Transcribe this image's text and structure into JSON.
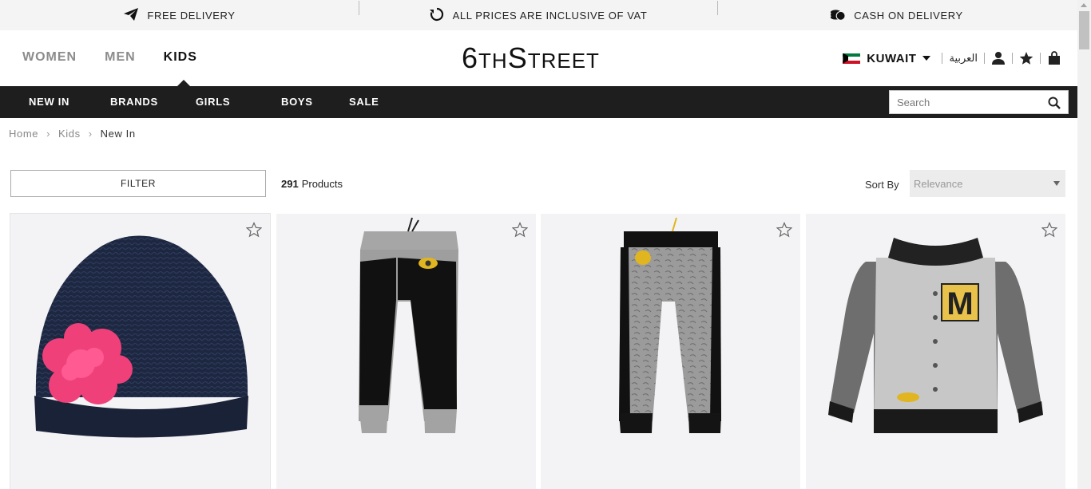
{
  "promo": {
    "items": [
      {
        "icon": "paper-plane-icon",
        "label": "FREE DELIVERY"
      },
      {
        "icon": "refresh-icon",
        "label": "ALL PRICES ARE INCLUSIVE OF VAT"
      },
      {
        "icon": "coins-icon",
        "label": "CASH ON DELIVERY"
      }
    ]
  },
  "header": {
    "gender_tabs": [
      {
        "label": "WOMEN",
        "active": false
      },
      {
        "label": "MEN",
        "active": false
      },
      {
        "label": "KIDS",
        "active": true
      }
    ],
    "logo_main": "6",
    "logo_th": "TH",
    "logo_s": "S",
    "logo_rest": "TREET",
    "country": "KUWAIT",
    "language": "العربية"
  },
  "catnav": {
    "items": [
      "NEW IN",
      "BRANDS",
      "GIRLS",
      "BOYS",
      "SALE"
    ]
  },
  "search": {
    "placeholder": "Search"
  },
  "breadcrumb": {
    "items": [
      "Home",
      "Kids",
      "New In"
    ]
  },
  "toolbar": {
    "filter_label": "FILTER",
    "product_count": "291",
    "product_count_label": "Products",
    "sort_label": "Sort By",
    "sort_value": "Relevance"
  },
  "products": [
    {
      "name": "navy-knit-beanie-with-pink-flower"
    },
    {
      "name": "grey-black-minion-joggers"
    },
    {
      "name": "grey-print-minion-joggers"
    },
    {
      "name": "grey-minion-varsity-jacket"
    }
  ],
  "colors": {
    "catbar": "#1e1e1e",
    "promo_bg": "#f4f4f4",
    "card_bg": "#f3f3f5"
  }
}
